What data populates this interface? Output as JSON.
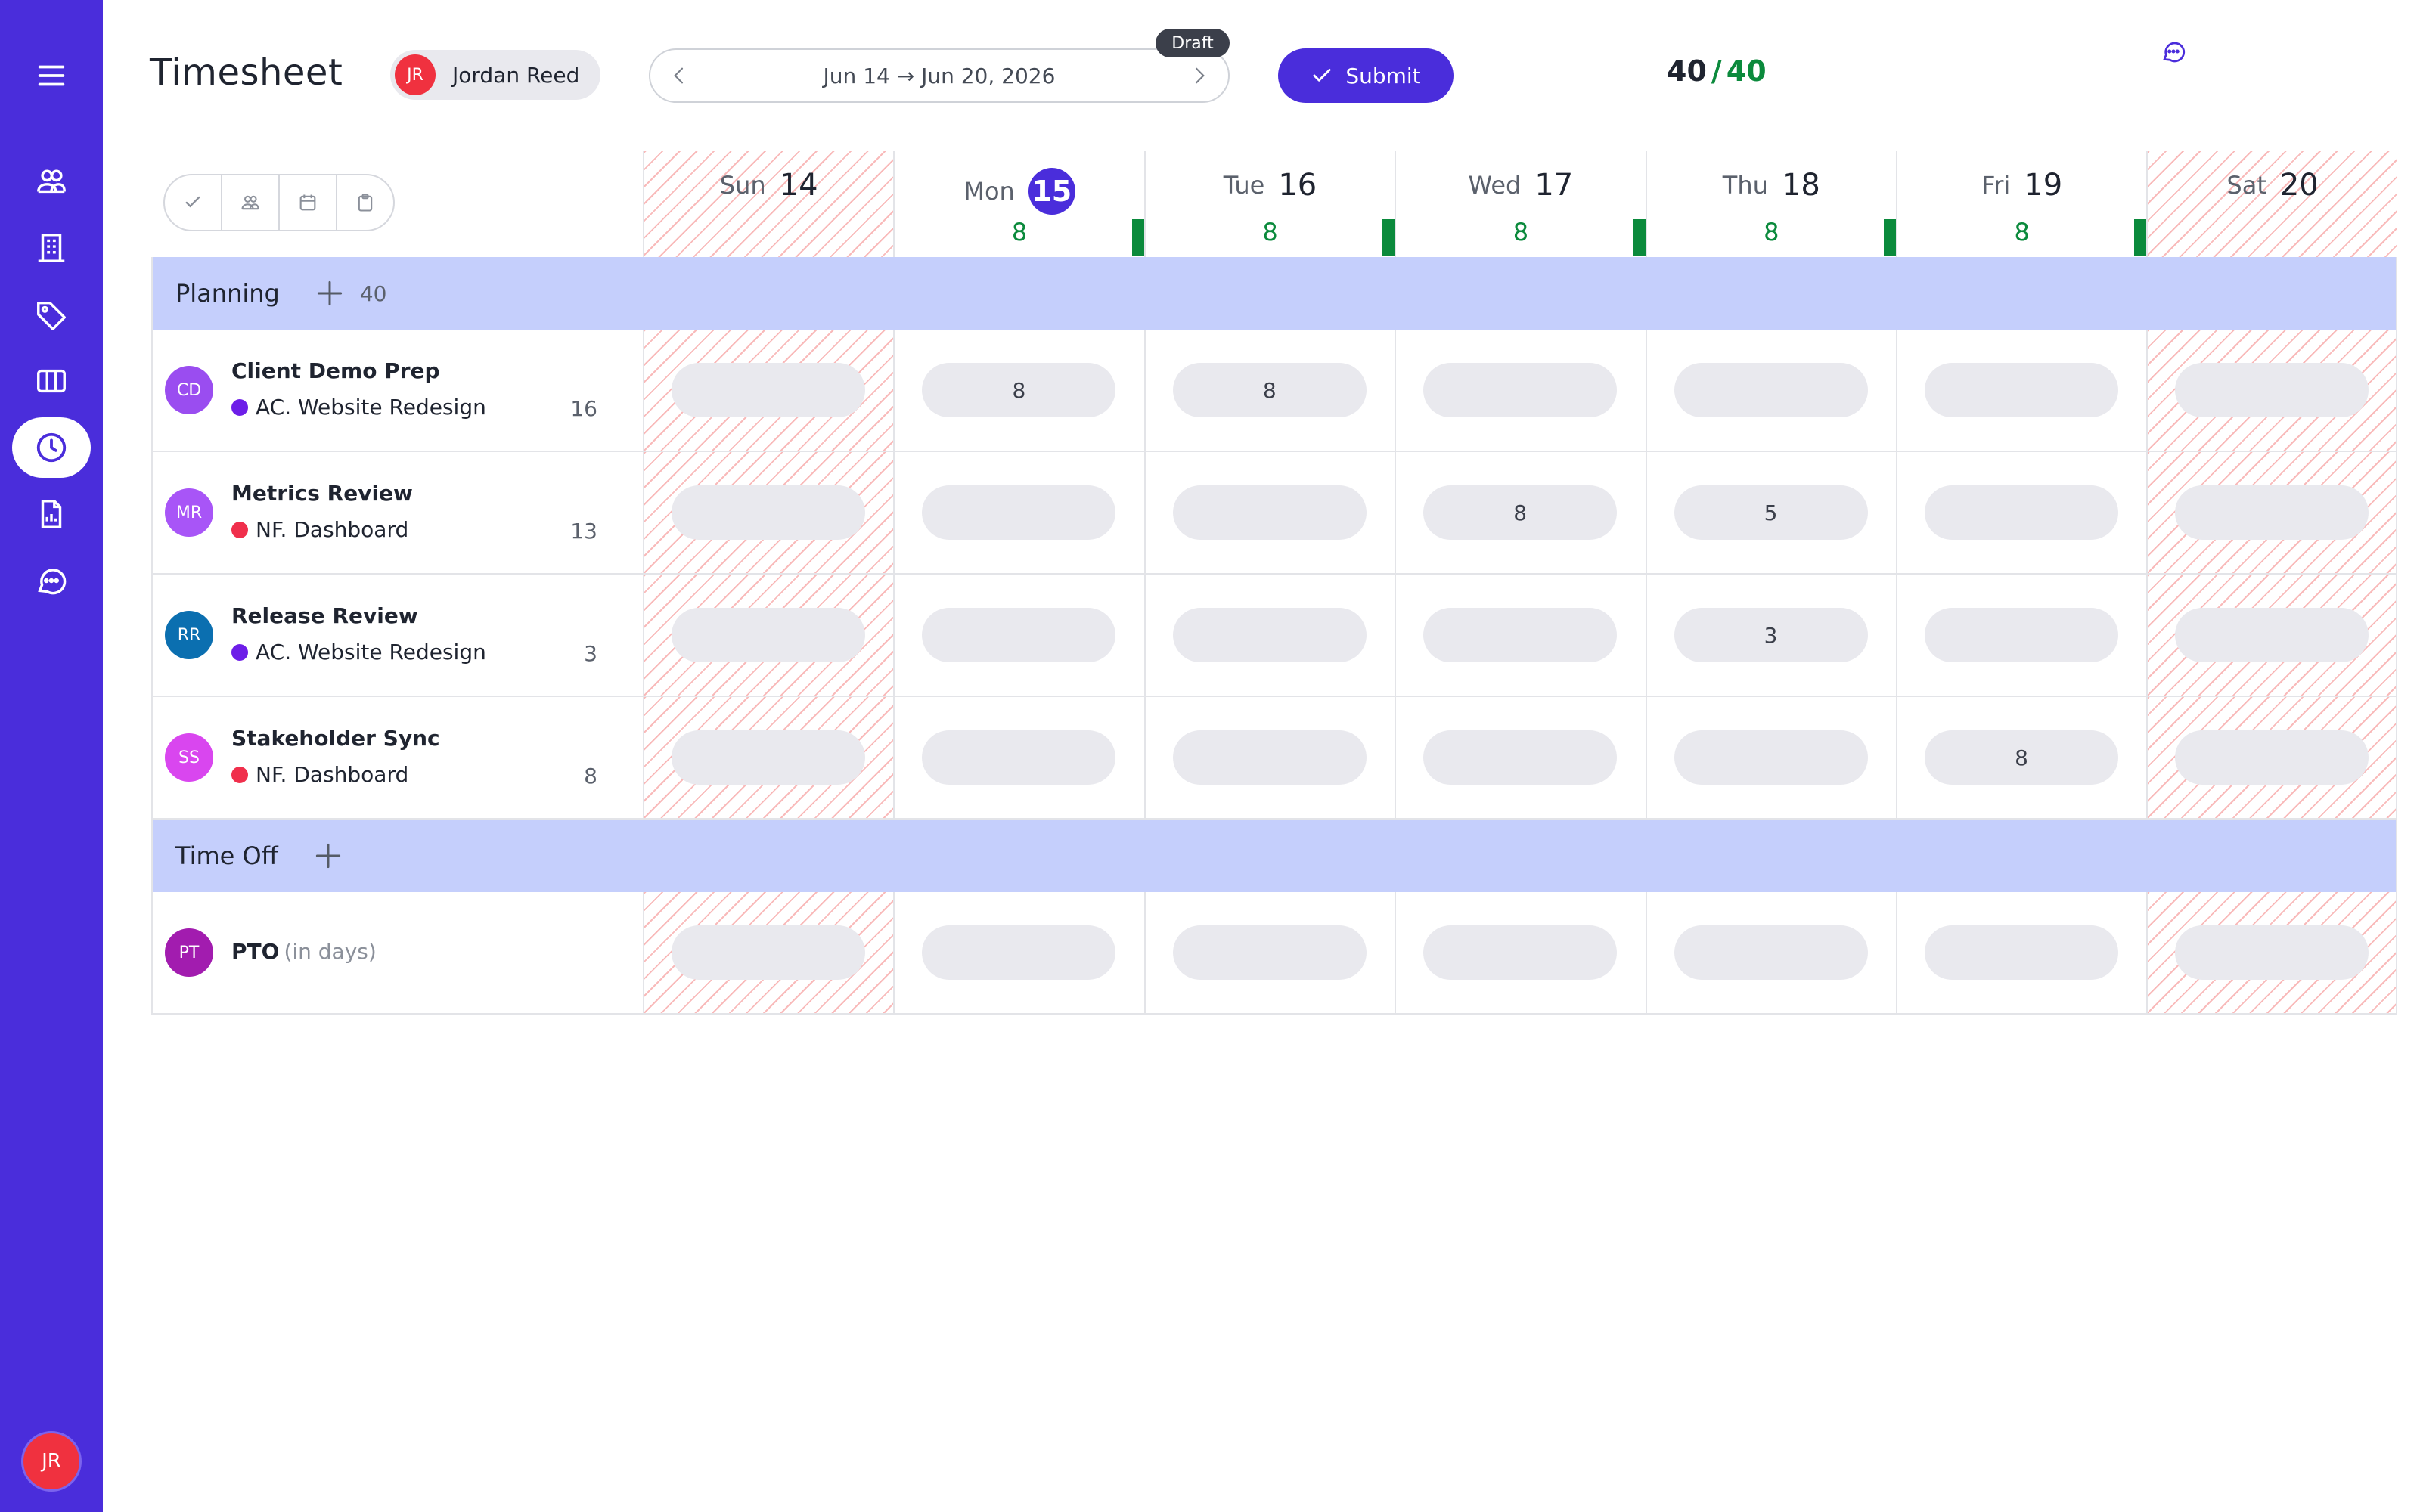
{
  "app": {
    "title": "Timesheet",
    "accent": "#4a2ddb",
    "ok_color": "#0b8a3c"
  },
  "sidebar": {
    "items": [
      {
        "icon": "menu-icon"
      },
      {
        "icon": "people-icon"
      },
      {
        "icon": "building-icon"
      },
      {
        "icon": "tag-icon"
      },
      {
        "icon": "columns-icon"
      },
      {
        "icon": "clock-icon",
        "active": true
      },
      {
        "icon": "report-icon"
      },
      {
        "icon": "chat-icon"
      }
    ],
    "user_initials": "JR"
  },
  "header": {
    "user_initials": "JR",
    "user_name": "Jordan Reed",
    "date_range": "Jun 14 → Jun 20, 2026",
    "status_badge": "Draft",
    "submit_label": "Submit",
    "total_logged": "40",
    "total_sep": "/",
    "total_target": "40"
  },
  "days": [
    {
      "name": "Sun",
      "date": "14",
      "hours": "",
      "weekend": true
    },
    {
      "name": "Mon",
      "date": "15",
      "hours": "8",
      "today": true
    },
    {
      "name": "Tue",
      "date": "16",
      "hours": "8"
    },
    {
      "name": "Wed",
      "date": "17",
      "hours": "8"
    },
    {
      "name": "Thu",
      "date": "18",
      "hours": "8"
    },
    {
      "name": "Fri",
      "date": "19",
      "hours": "8"
    },
    {
      "name": "Sat",
      "date": "20",
      "hours": "",
      "weekend": true
    }
  ],
  "groups": {
    "planning": {
      "name": "Planning",
      "total": "40"
    },
    "timeoff": {
      "name": "Time Off"
    }
  },
  "tasks": [
    {
      "initials": "CD",
      "name": "Client Demo Prep",
      "project": "AC. Website Redesign",
      "project_color": "#6d1ee8",
      "avatar_color": "#9a4df0",
      "total": "16",
      "hours": [
        "",
        "8",
        "8",
        "",
        "",
        "",
        ""
      ]
    },
    {
      "initials": "MR",
      "name": "Metrics Review",
      "project": "NF. Dashboard",
      "project_color": "#f02f4c",
      "avatar_color": "#a855f7",
      "total": "13",
      "hours": [
        "",
        "",
        "",
        "8",
        "5",
        "",
        ""
      ]
    },
    {
      "initials": "RR",
      "name": "Release Review",
      "project": "AC. Website Redesign",
      "project_color": "#6d1ee8",
      "avatar_color": "#0b6fb0",
      "total": "3",
      "hours": [
        "",
        "",
        "",
        "",
        "3",
        "",
        ""
      ]
    },
    {
      "initials": "SS",
      "name": "Stakeholder Sync",
      "project": "NF. Dashboard",
      "project_color": "#f02f4c",
      "avatar_color": "#d946ef",
      "total": "8",
      "hours": [
        "",
        "",
        "",
        "",
        "",
        "8",
        ""
      ]
    }
  ],
  "pto": {
    "initials": "PT",
    "name": "PTO",
    "unit": "(in days)",
    "avatar_color": "#a21caf",
    "hours": [
      "",
      "",
      "",
      "",
      "",
      "",
      ""
    ]
  }
}
